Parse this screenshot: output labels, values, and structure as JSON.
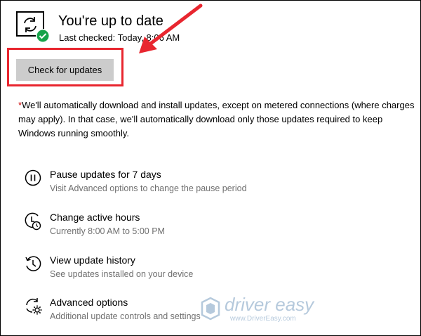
{
  "status": {
    "title": "You're up to date",
    "last_checked": "Last checked: Today, 8:06 AM",
    "icon": "sync-check-icon"
  },
  "check_button": {
    "label": "Check for updates"
  },
  "note": {
    "asterisk": "*",
    "text": "We'll automatically download and install updates, except on metered connections (where charges may apply). In that case, we'll automatically download only those updates required to keep Windows running smoothly."
  },
  "options": [
    {
      "title": "Pause updates for 7 days",
      "desc": "Visit Advanced options to change the pause period",
      "icon": "pause-icon"
    },
    {
      "title": "Change active hours",
      "desc": "Currently 8:00 AM to 5:00 PM",
      "icon": "clock-icon"
    },
    {
      "title": "View update history",
      "desc": "See updates installed on your device",
      "icon": "history-icon"
    },
    {
      "title": "Advanced options",
      "desc": "Additional update controls and settings",
      "icon": "settings-sync-icon"
    }
  ],
  "watermark": {
    "brand": "driver easy",
    "url": "www.DriverEasy.com"
  },
  "colors": {
    "highlight": "#e8262f",
    "button": "#cccccc",
    "check": "#16a34a",
    "secondary_text": "#707070"
  }
}
